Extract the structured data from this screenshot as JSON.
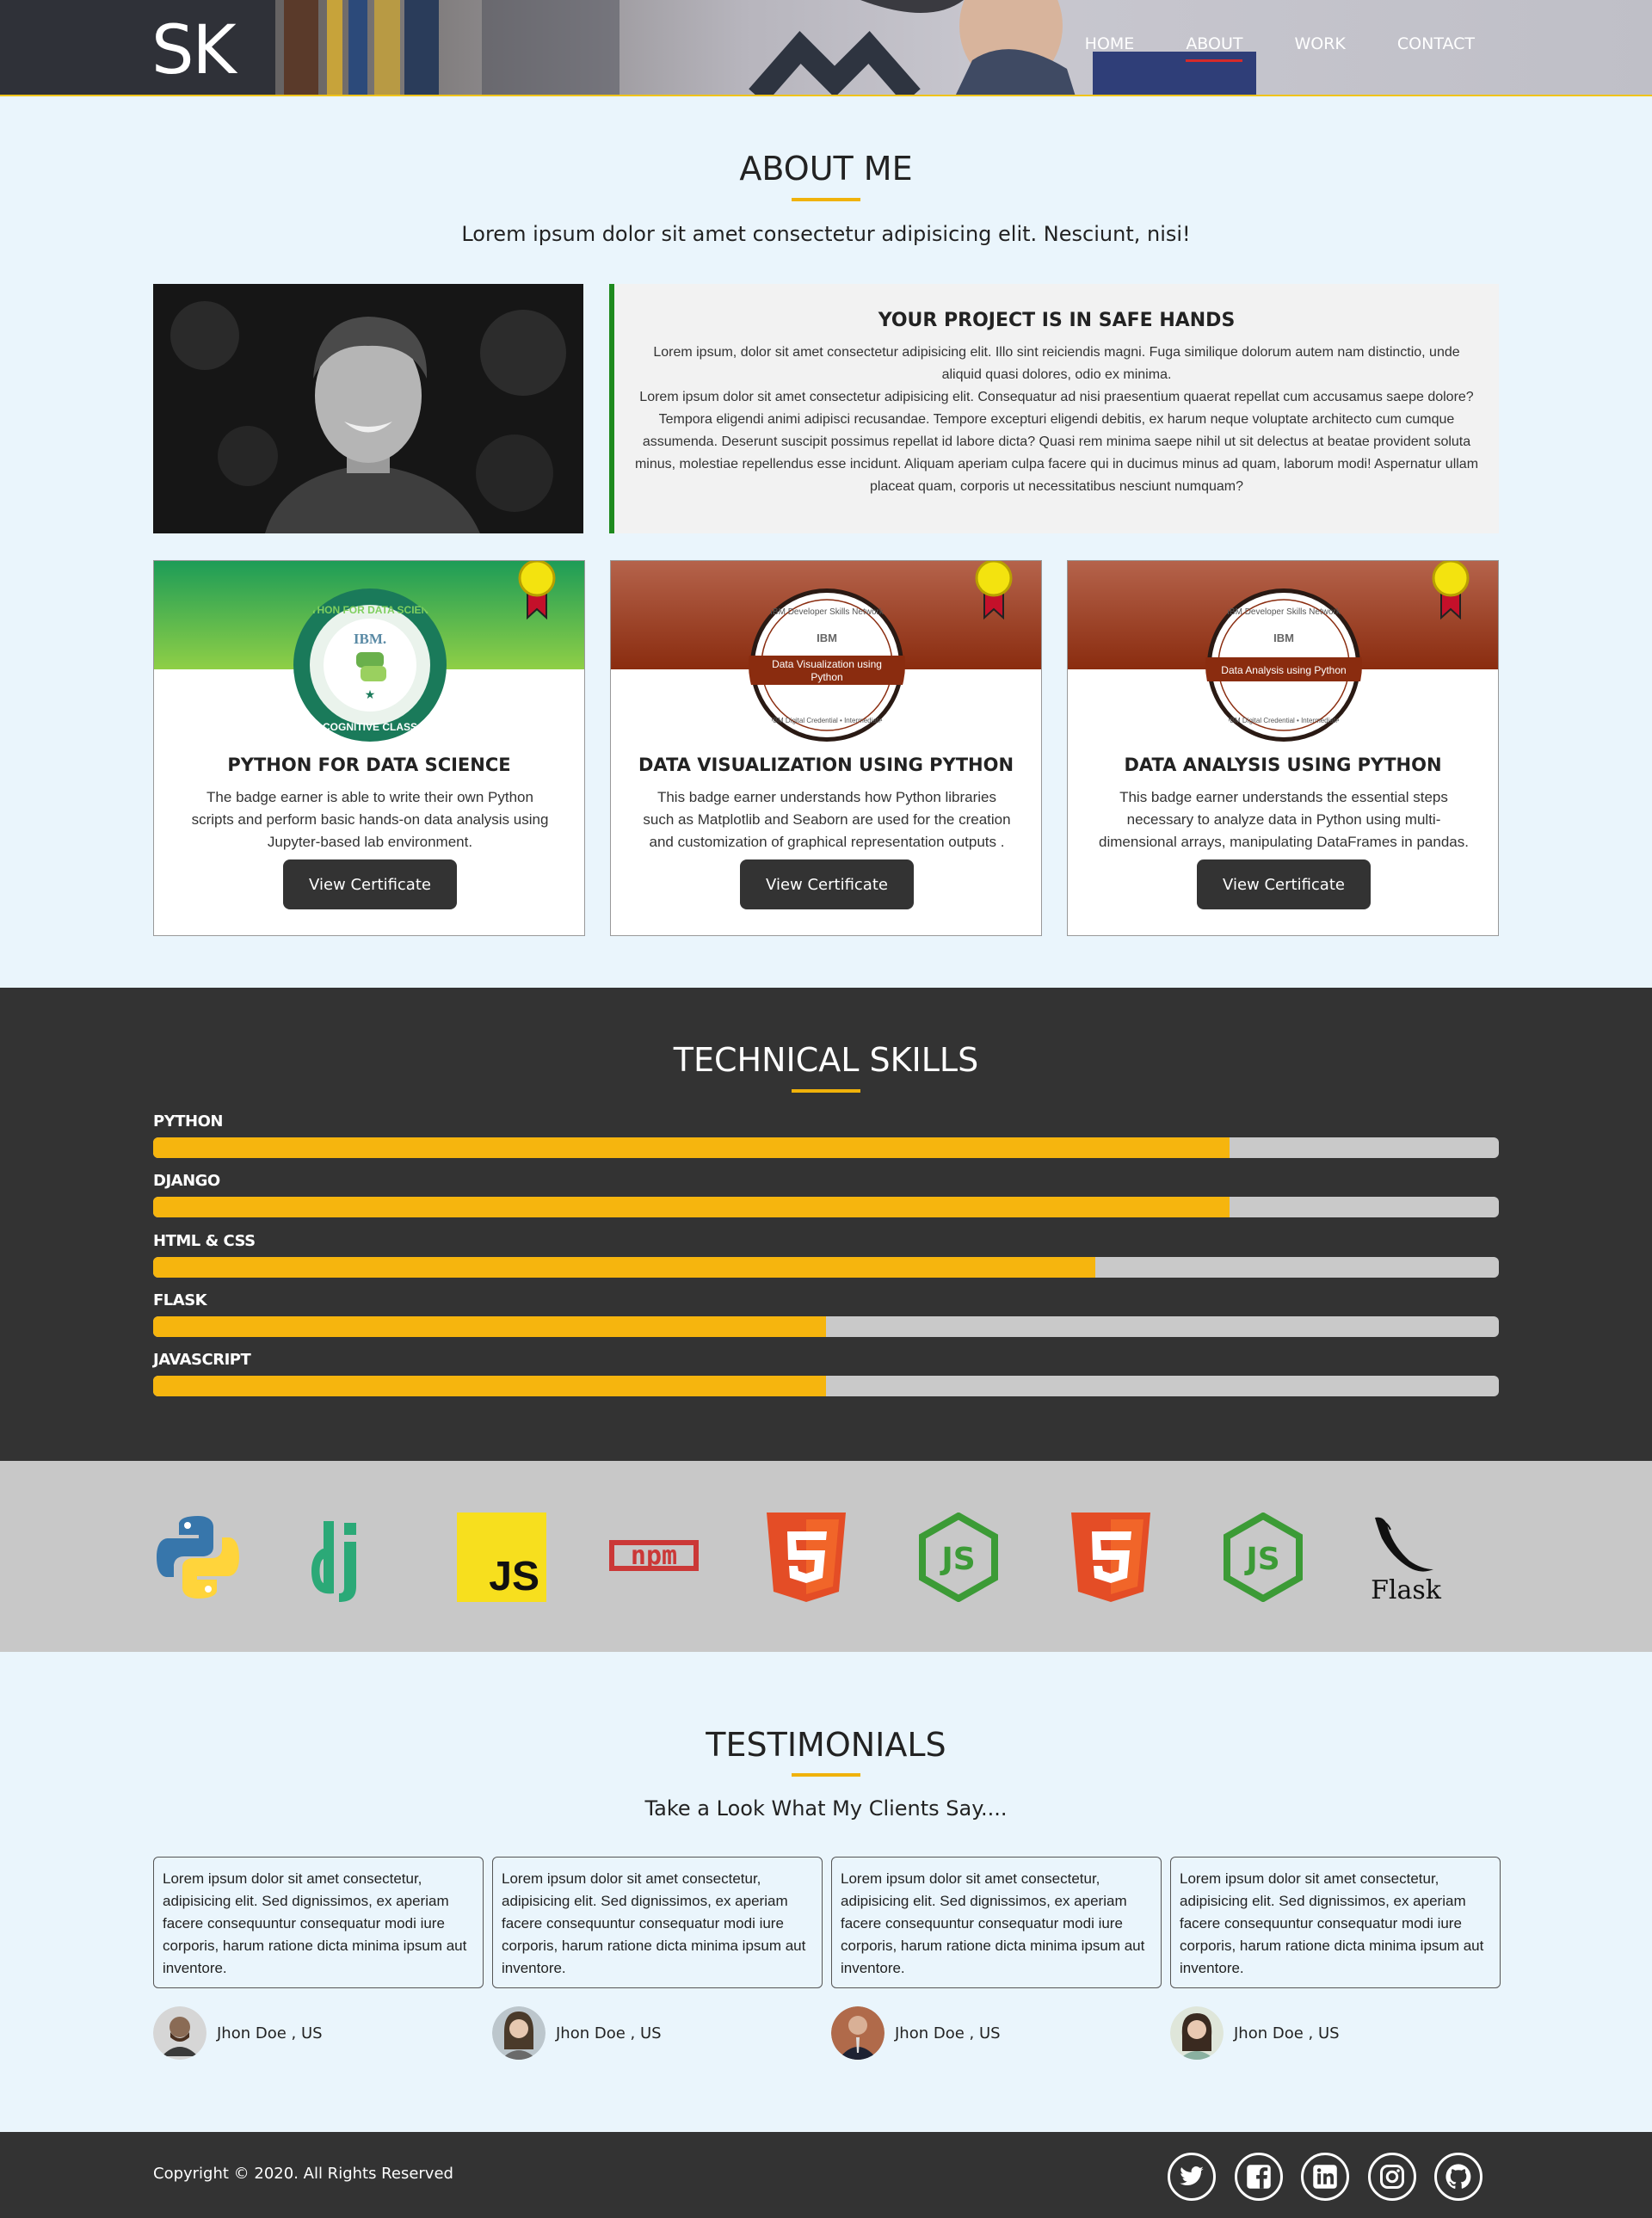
{
  "header": {
    "logo": "SK",
    "nav": [
      {
        "label": "HOME"
      },
      {
        "label": "ABOUT",
        "active": true
      },
      {
        "label": "WORK"
      },
      {
        "label": "CONTACT"
      }
    ]
  },
  "about": {
    "title": "ABOUT ME",
    "subtitle": "Lorem ipsum dolor sit amet consectetur adipisicing elit. Nesciunt, nisi!",
    "box_title": "YOUR PROJECT IS IN SAFE HANDS",
    "box_text_1": "Lorem ipsum, dolor sit amet consectetur adipisicing elit. Illo sint reiciendis magni. Fuga similique dolorum autem nam distinctio, unde aliquid quasi dolores, odio ex minima.",
    "box_text_2": "Lorem ipsum dolor sit amet consectetur adipisicing elit. Consequatur ad nisi praesentium quaerat repellat cum accusamus saepe dolore? Tempora eligendi animi adipisci recusandae. Tempore excepturi eligendi debitis, ex harum neque voluptate architecto cum cumque assumenda. Deserunt suscipit possimus repellat id labore dicta? Quasi rem minima saepe nihil ut sit delectus at beatae provident soluta minus, molestiae repellendus esse incidunt. Aliquam aperiam culpa facere qui in ducimus minus ad quam, laborum modi! Aspernatur ullam placeat quam, corporis ut necessitatibus nesciunt numquam?"
  },
  "certificates": [
    {
      "title": "PYTHON FOR DATA SCIENCE",
      "text": "The badge earner is able to write their own Python scripts and perform basic hands-on data analysis using Jupyter-based lab environment.",
      "button": "View Certificate",
      "badge_top": "PYTHON FOR DATA SCIENCE",
      "badge_brand": "IBM.",
      "badge_bottom": "COGNITIVE CLASS"
    },
    {
      "title": "DATA VISUALIZATION USING PYTHON",
      "text": "This badge earner understands how Python libraries such as Matplotlib and Seaborn are used for the creation and customization of graphical representation outputs .",
      "button": "View Certificate",
      "badge_top": "IBM Developer Skills Network",
      "badge_brand": "IBM",
      "badge_label": "Data Visualization using Python",
      "badge_bottom": "IBM Digital Credential • Intermediate"
    },
    {
      "title": "DATA ANALYSIS USING PYTHON",
      "text": "This badge earner understands the essential steps necessary to analyze data in Python using multi-dimensional arrays, manipulating DataFrames in pandas.",
      "button": "View Certificate",
      "badge_top": "IBM Developer Skills Network",
      "badge_brand": "IBM",
      "badge_label": "Data Analysis using Python",
      "badge_bottom": "IBM Digital Credential • Intermediate"
    }
  ],
  "skills": {
    "title": "TECHNICAL SKILLS",
    "items": [
      {
        "name": "PYTHON",
        "level": 0.8
      },
      {
        "name": "DJANGO",
        "level": 0.8
      },
      {
        "name": "HTML & CSS",
        "level": 0.7
      },
      {
        "name": "FLASK",
        "level": 0.5
      },
      {
        "name": "JAVASCRIPT",
        "level": 0.5
      }
    ]
  },
  "tech_logos": {
    "js_text": "JS",
    "npm_text": "npm",
    "flask_text": "Flask",
    "icons": [
      "python-logo-icon",
      "django-logo-icon",
      "javascript-logo-icon",
      "npm-logo-icon",
      "html5-logo-icon",
      "nodejs-logo-icon",
      "html5-logo-icon",
      "nodejs-logo-icon",
      "flask-logo-icon"
    ]
  },
  "testimonials": {
    "title": "TESTIMONIALS",
    "subtitle": "Take a Look What My Clients Say....",
    "items": [
      {
        "text": "Lorem ipsum dolor sit amet consectetur, adipisicing elit. Sed dignissimos, ex aperiam facere consequuntur consequatur modi iure corporis, harum ratione dicta minima ipsum aut inventore.",
        "author": "Jhon Doe , US"
      },
      {
        "text": "Lorem ipsum dolor sit amet consectetur, adipisicing elit. Sed dignissimos, ex aperiam facere consequuntur consequatur modi iure corporis, harum ratione dicta minima ipsum aut inventore.",
        "author": "Jhon Doe , US"
      },
      {
        "text": "Lorem ipsum dolor sit amet consectetur, adipisicing elit. Sed dignissimos, ex aperiam facere consequuntur consequatur modi iure corporis, harum ratione dicta minima ipsum aut inventore.",
        "author": "Jhon Doe , US"
      },
      {
        "text": "Lorem ipsum dolor sit amet consectetur, adipisicing elit. Sed dignissimos, ex aperiam facere consequuntur consequatur modi iure corporis, harum ratione dicta minima ipsum aut inventore.",
        "author": "Jhon Doe , US"
      }
    ]
  },
  "footer": {
    "copyright": "Copyright © 2020. All Rights Reserved",
    "social": [
      "twitter-icon",
      "facebook-icon",
      "linkedin-icon",
      "instagram-icon",
      "github-icon"
    ]
  },
  "colors": {
    "accent": "#f0b20a",
    "skill_fill": "#f6b50e",
    "dark": "#333333",
    "nav_underline": "#d62a2a",
    "info_border": "#1e8a1e"
  }
}
